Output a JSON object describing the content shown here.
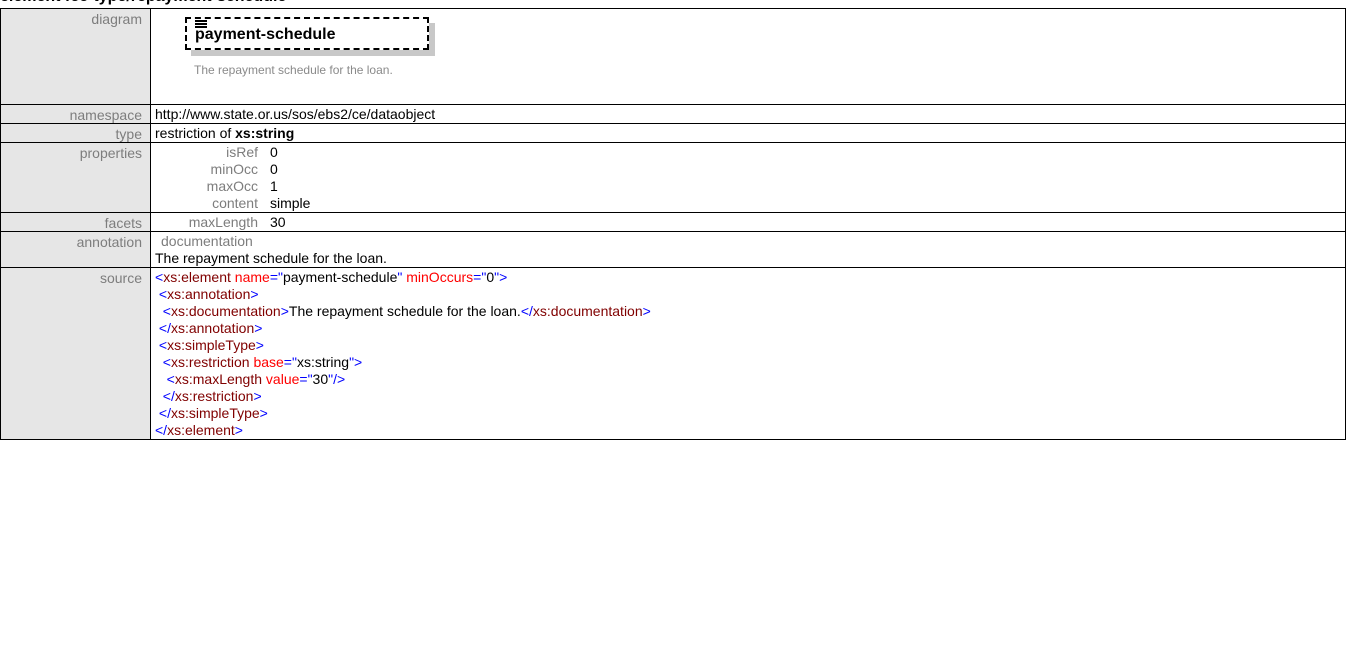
{
  "heading": "element fee-type/repayment-schedule",
  "labels": {
    "diagram": "diagram",
    "namespace": "namespace",
    "type": "type",
    "properties": "properties",
    "facets": "facets",
    "annotation": "annotation",
    "source": "source"
  },
  "diagram": {
    "element_name": "payment-schedule",
    "documentation": "The repayment schedule for the loan.",
    "icon": "documentation-icon"
  },
  "namespace": "http://www.state.or.us/sos/ebs2/ce/dataobject",
  "type": {
    "prefix": "restriction of ",
    "base": "xs:string"
  },
  "properties": [
    {
      "key": "isRef",
      "value": "0"
    },
    {
      "key": "minOcc",
      "value": "0"
    },
    {
      "key": "maxOcc",
      "value": "1"
    },
    {
      "key": "content",
      "value": "simple"
    }
  ],
  "facets": [
    {
      "key": "maxLength",
      "value": "30"
    }
  ],
  "annotation": {
    "head": "documentation",
    "text": "The repayment schedule for the loan."
  },
  "source": {
    "element_tag": "xs:element",
    "name_attr": "name",
    "name_val": "payment-schedule",
    "minocc_attr": "minOccurs",
    "minocc_val": "0",
    "annotation_tag": "xs:annotation",
    "documentation_tag": "xs:documentation",
    "documentation_text": "The repayment schedule for the loan.",
    "simpletype_tag": "xs:simpleType",
    "restriction_tag": "xs:restriction",
    "base_attr": "base",
    "base_val": "xs:string",
    "maxlength_tag": "xs:maxLength",
    "value_attr": "value",
    "value_val": "30"
  },
  "colors": {
    "tag_bracket": "#0000ff",
    "tag_name": "#800000",
    "attr_name": "#ff0000",
    "label_bg": "#e6e6e6",
    "label_text": "#7d7d7d"
  }
}
